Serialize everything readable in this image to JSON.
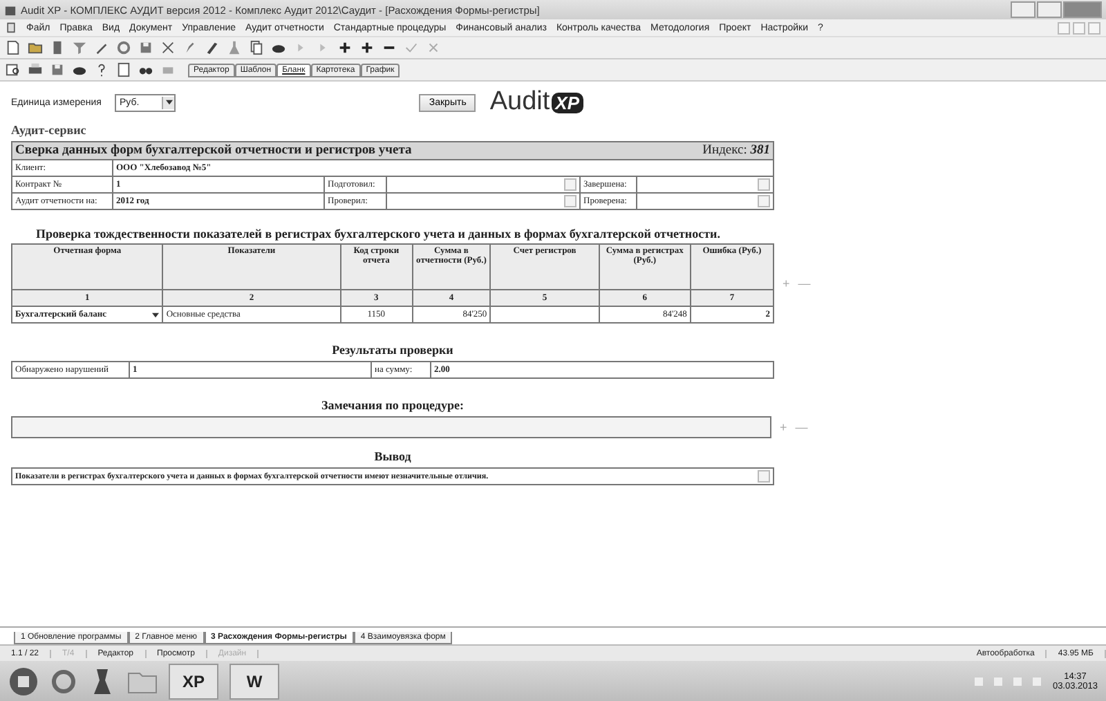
{
  "window": {
    "title": "Audit XP - КОМПЛЕКС АУДИТ версия 2012 - Комплекс Аудит 2012\\Саудит - [Расхождения Формы-регистры]"
  },
  "menu": [
    "Файл",
    "Правка",
    "Вид",
    "Документ",
    "Управление",
    "Аудит отчетности",
    "Стандартные процедуры",
    "Финансовый анализ",
    "Контроль качества",
    "Методология",
    "Проект",
    "Настройки",
    "?"
  ],
  "view_tabs": [
    {
      "label": "Редактор",
      "selected": false
    },
    {
      "label": "Шаблон",
      "selected": false
    },
    {
      "label": "Бланк",
      "selected": true
    },
    {
      "label": "Картотека",
      "selected": false
    },
    {
      "label": "График",
      "selected": false
    }
  ],
  "unit": {
    "label": "Единица измерения",
    "value": "Руб."
  },
  "close_button": "Закрыть",
  "logo": {
    "text": "Audit",
    "badge": "XP"
  },
  "company": "Аудит-сервис",
  "header": {
    "title": "Сверка данных форм бухгалтерской отчетности и регистров учета",
    "index_label": "Индекс:",
    "index": "381",
    "client_label": "Клиент:",
    "client": "ООО \"Хлебозавод №5\"",
    "rows": [
      {
        "label": "Контракт №",
        "value": "1",
        "l2": "Подготовил:",
        "l3": "Завершена:"
      },
      {
        "label": "Аудит отчетности на:",
        "value": "2012 год",
        "l2": "Проверил:",
        "l3": "Проверена:"
      }
    ]
  },
  "check_title": "Проверка тождественности показателей в  регистрах бухгалтерского учета и данных в формах бухгалтерской отчетности.",
  "table": {
    "columns": [
      "Отчетная форма",
      "Показатели",
      "Код строки отчета",
      "Сумма в отчетности (Руб.)",
      "Счет регистров",
      "Сумма в регистрах (Руб.)",
      "Ошибка (Руб.)"
    ],
    "numbers": [
      "1",
      "2",
      "3",
      "4",
      "5",
      "6",
      "7"
    ],
    "rows": [
      [
        "Бухгалтерский баланс",
        "Основные средства",
        "1150",
        "84'250",
        "",
        "84'248",
        "2"
      ]
    ]
  },
  "results": {
    "title": "Результаты проверки",
    "found_label": "Обнаружено нарушений",
    "found": "1",
    "sum_label": "на сумму:",
    "sum": "2.00"
  },
  "row_actions": {
    "add": "+",
    "remove": "—"
  },
  "remarks_title": "Замечания по процедуре:",
  "conclusion": {
    "title": "Вывод",
    "text": "Показатели в   регистрах бухгалтерского учета и данных в формах бухгалтерской отчетности имеют незначительные отличия."
  },
  "doc_tabs": [
    {
      "label": "1 Обновление программы",
      "selected": false
    },
    {
      "label": "2 Главное меню",
      "selected": false
    },
    {
      "label": "3 Расхождения Формы-регистры",
      "selected": true
    },
    {
      "label": "4 Взаимоувязка форм",
      "selected": false
    }
  ],
  "status": {
    "page": "1.1 / 22",
    "modes": [
      {
        "label": "T/4",
        "disabled": true
      },
      {
        "label": "Редактор",
        "disabled": false
      },
      {
        "label": "Просмотр",
        "disabled": false
      },
      {
        "label": "Дизайн",
        "disabled": true
      }
    ],
    "auto": "Автообработка",
    "memory": "43.95 МБ"
  },
  "taskbar": {
    "apps": [
      "XP",
      "W"
    ],
    "time": "14:37",
    "date": "03.03.2013"
  }
}
